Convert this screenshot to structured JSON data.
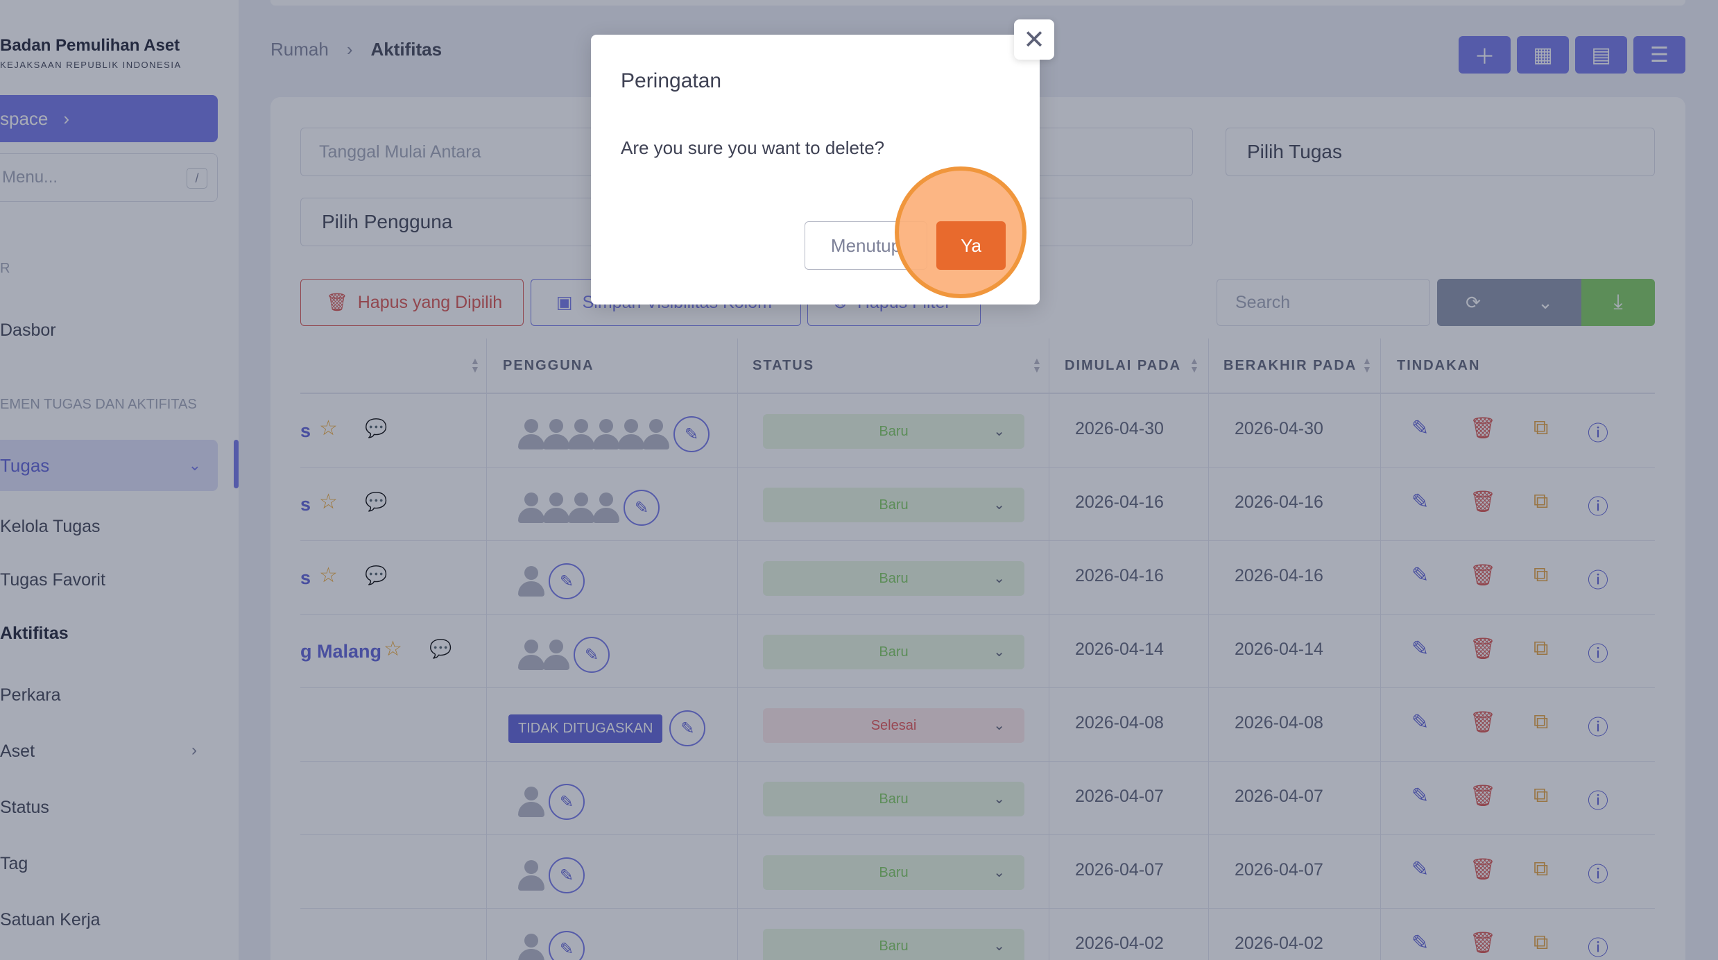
{
  "sidebar": {
    "brand_title": "Badan Pemulihan Aset",
    "brand_subtitle": "KEJAKSAAN REPUBLIK INDONESIA",
    "workspace_label": "space",
    "menu_search_placeholder": "Menu...",
    "menu_search_shortcut": "/",
    "section_1": "R",
    "dashboard": "Dasbor",
    "section_2": "EMEN TUGAS DAN AKTIFITAS",
    "tasks": "Tugas",
    "manage_tasks": "Kelola Tugas",
    "favorite_tasks": "Tugas Favorit",
    "activities": "Aktifitas",
    "cases": "Perkara",
    "assets": "Aset",
    "status": "Status",
    "tag": "Tag",
    "work_unit": "Satuan Kerja"
  },
  "breadcrumb": {
    "home": "Rumah",
    "current": "Aktifitas"
  },
  "filters": {
    "date_range_placeholder": "Tanggal Mulai Antara",
    "task_select": "Pilih Tugas",
    "user_select": "Pilih Pengguna"
  },
  "toolbar": {
    "delete_selected": "Hapus yang Dipilih",
    "save_visibility": "Simpan Visibilitas Kolom",
    "clear_filter": "Hapus Filter",
    "search_placeholder": "Search"
  },
  "table": {
    "headers": {
      "user": "PENGGUNA",
      "status": "STATUS",
      "started": "DIMULAI PADA",
      "ended": "BERAKHIR PADA",
      "actions": "TINDAKAN"
    },
    "rows": [
      {
        "name": "s",
        "avatars": 6,
        "status": "Baru",
        "status_type": "new",
        "start": "2026-04-30",
        "end": "2026-04-30"
      },
      {
        "name": "s",
        "avatars": 4,
        "status": "Baru",
        "status_type": "new",
        "start": "2026-04-16",
        "end": "2026-04-16"
      },
      {
        "name": "s",
        "avatars": 1,
        "status": "Baru",
        "status_type": "new",
        "start": "2026-04-16",
        "end": "2026-04-16"
      },
      {
        "name": "g Malang",
        "avatars": 2,
        "status": "Baru",
        "status_type": "new",
        "start": "2026-04-14",
        "end": "2026-04-14"
      },
      {
        "name": "",
        "avatars": 0,
        "unassigned": "TIDAK DITUGASKAN",
        "status": "Selesai",
        "status_type": "done",
        "start": "2026-04-08",
        "end": "2026-04-08"
      },
      {
        "name": "",
        "avatars": 1,
        "status": "Baru",
        "status_type": "new",
        "start": "2026-04-07",
        "end": "2026-04-07"
      },
      {
        "name": "",
        "avatars": 1,
        "status": "Baru",
        "status_type": "new",
        "start": "2026-04-07",
        "end": "2026-04-07"
      },
      {
        "name": "",
        "avatars": 1,
        "status": "Baru",
        "status_type": "new",
        "start": "2026-04-02",
        "end": "2026-04-02"
      }
    ]
  },
  "modal": {
    "title": "Peringatan",
    "message": "Are you sure you want to delete?",
    "cancel_label": "Menutup",
    "confirm_label": "Ya",
    "close_icon": "close-icon"
  },
  "colors": {
    "accent": "#7376e8",
    "danger": "#d9534f",
    "confirm": "#e86a2d",
    "success": "#7ecb5e"
  }
}
